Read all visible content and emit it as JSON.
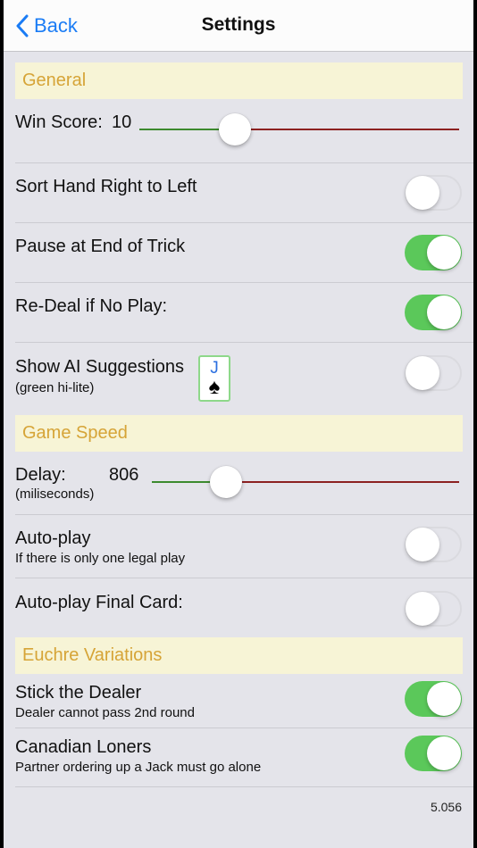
{
  "nav": {
    "back_label": "Back",
    "title": "Settings"
  },
  "sections": {
    "general": "General",
    "game_speed": "Game Speed",
    "euchre_variations": "Euchre Variations"
  },
  "win_score": {
    "label": "Win Score:",
    "value": "10",
    "slider_fraction": 0.3
  },
  "sort_hand": {
    "label": "Sort Hand Right to Left",
    "on": false
  },
  "pause_trick": {
    "label": "Pause at End of Trick",
    "on": true
  },
  "redeal": {
    "label": "Re-Deal if No Play:",
    "on": true
  },
  "ai_suggestions": {
    "label": "Show AI Suggestions",
    "sub": "(green hi-lite)",
    "card_rank": "J",
    "card_suit": "♠",
    "on": false
  },
  "delay": {
    "label": "Delay:",
    "value": "806",
    "sub": "(miliseconds)",
    "slider_fraction": 0.24
  },
  "auto_play": {
    "label": "Auto-play",
    "sub": "If there is only one legal play",
    "on": false
  },
  "auto_play_final": {
    "label": "Auto-play Final Card:",
    "on": false
  },
  "stick_dealer": {
    "label": "Stick the Dealer",
    "sub": "Dealer cannot pass 2nd round",
    "on": true
  },
  "canadian_loners": {
    "label": "Canadian Loners",
    "sub": "Partner ordering up a Jack must go alone",
    "on": true
  },
  "version": "5.056",
  "colors": {
    "accent": "#1a7cf5",
    "header_bg": "#f7f4d6",
    "header_text": "#d6a437",
    "switch_on": "#5bc85a",
    "slider_min": "#3c8a2e",
    "slider_max": "#8c2121"
  },
  "icons": {
    "back": "chevron-left-icon"
  }
}
